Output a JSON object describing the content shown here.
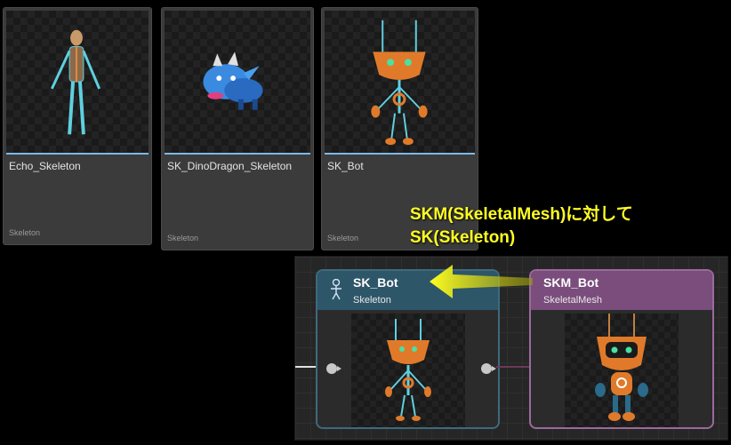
{
  "assets": [
    {
      "name": "Echo_Skeleton",
      "type": "Skeleton",
      "icon": "humanoid-skeleton-thumbnail"
    },
    {
      "name": "SK_DinoDragon_Skeleton",
      "type": "Skeleton",
      "icon": "blue-dragon-thumbnail"
    },
    {
      "name": "SK_Bot",
      "type": "Skeleton",
      "icon": "orange-bot-thumbnail"
    }
  ],
  "annotation": {
    "line1": "SKM(SkeletalMesh)に対して",
    "line2": "SK(Skeleton)"
  },
  "graph": {
    "skeleton_node": {
      "title": "SK_Bot",
      "subtitle": "Skeleton",
      "icon": "skeleton-icon"
    },
    "mesh_node": {
      "title": "SKM_Bot",
      "subtitle": "SkeletalMesh"
    }
  },
  "colors": {
    "accent": "#7cb9e8",
    "annotation": "#ffff22",
    "skeleton_header": "#2e5669",
    "mesh_header": "#7a4d7c"
  }
}
